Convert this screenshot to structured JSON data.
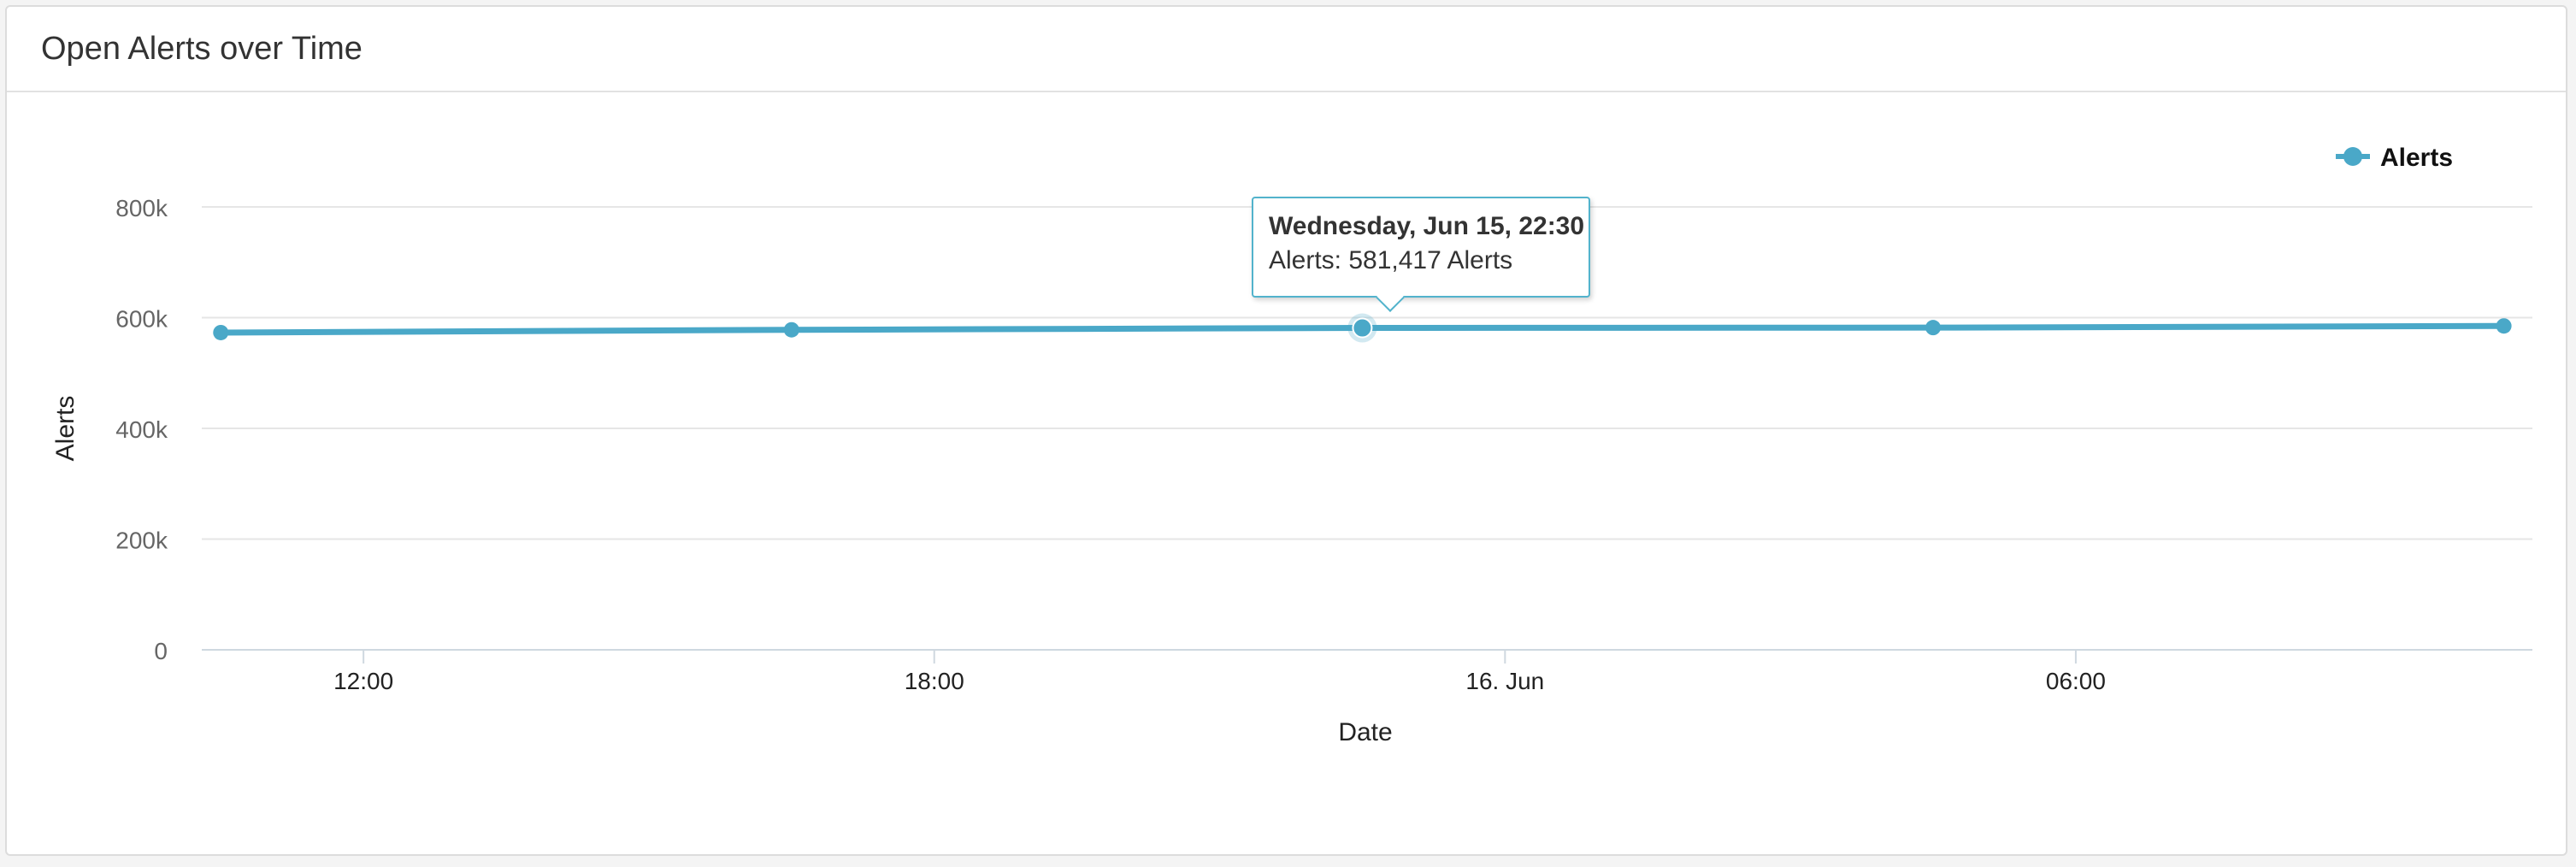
{
  "panel": {
    "title": "Open Alerts over Time"
  },
  "colors": {
    "series": "#4aa8c8",
    "grid": "#e6e6e6",
    "axis_text": "#666666",
    "label_text": "#222222"
  },
  "chart_data": {
    "type": "line",
    "title": "Open Alerts over Time",
    "xlabel": "Date",
    "ylabel": "Alerts",
    "x_tick_labels": [
      "12:00",
      "18:00",
      "16. Jun",
      "06:00"
    ],
    "y_tick_labels": [
      "0",
      "200k",
      "400k",
      "600k",
      "800k"
    ],
    "y_ticks": [
      0,
      200000,
      400000,
      600000,
      800000
    ],
    "ylim": [
      0,
      800000
    ],
    "x_ticks_hours": [
      12,
      18,
      24,
      30
    ],
    "xlim_hours": [
      10.3,
      34.8
    ],
    "grid": true,
    "legend": "top-right",
    "series": [
      {
        "name": "Alerts",
        "points": [
          {
            "x_hours": 10.5,
            "y": 573000
          },
          {
            "x_hours": 16.5,
            "y": 578000
          },
          {
            "x_hours": 22.5,
            "y": 581417
          },
          {
            "x_hours": 28.5,
            "y": 582000
          },
          {
            "x_hours": 34.5,
            "y": 585000
          }
        ]
      }
    ],
    "tooltip": {
      "point_index": 2,
      "title": "Wednesday, Jun 15, 22:30",
      "body": "Alerts: 581,417 Alerts"
    }
  }
}
